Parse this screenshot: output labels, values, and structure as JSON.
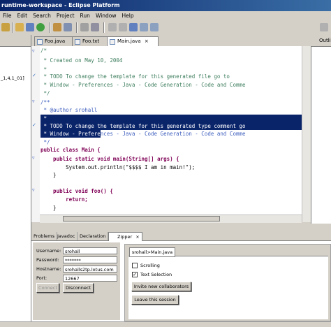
{
  "window": {
    "title": "runtime-workspace - Eclipse Platform"
  },
  "menu": [
    "File",
    "Edit",
    "Search",
    "Project",
    "Run",
    "Window",
    "Help"
  ],
  "editor_tabs": [
    {
      "label": "Foo.java",
      "active": false
    },
    {
      "label": "Foo.txt",
      "active": false
    },
    {
      "label": "Main.java",
      "active": true
    }
  ],
  "close_glyph": "×",
  "left_panel": {
    "tree_item": "_1,4,1_01]"
  },
  "right_panel": {
    "tab_label": "Outli"
  },
  "code_lines": [
    "/*",
    " * Created on May 10, 2004",
    " *",
    " * TODO To change the template for this generated file go to",
    " * Window - Preferences - Java - Code Generation - Code and Comme",
    " */",
    "/**",
    " * @author srohall",
    " *",
    " * TODO To change the template for this generated type comment go",
    " * Window - Preferences - Java - Code Generation - Code and Comme",
    " */",
    "public class Main {",
    "    public static void main(String[] args) {",
    "        System.out.println(\"$$$$ I am in main!\");",
    "    }",
    "",
    "    public void foo() {",
    "        return;",
    "    }"
  ],
  "bottom_tabs": [
    "Problems",
    "Javadoc",
    "Declaration",
    "Zipper"
  ],
  "zipper": {
    "username_label": "Username:",
    "username": "srohall",
    "password_label": "Password:",
    "password": "*******",
    "hostname_label": "Hostname:",
    "hostname": "srohalls2tp.lotus.com",
    "port_label": "Port:",
    "port": "12667",
    "connect_label": "Connect",
    "disconnect_label": "Disconnect",
    "session_tab": "srohall>Main.java",
    "scrolling_label": "Scrolling",
    "scrolling_checked": false,
    "text_selection_label": "Text Selection",
    "text_selection_checked": true,
    "invite_label": "Invite new collaborators",
    "leave_label": "Leave this session"
  },
  "colors": {
    "selection": "#0a246a",
    "keyword": "#7f0055",
    "comment": "#3f7f5f",
    "javadoc": "#3f5fbf",
    "string": "#2a00ff"
  }
}
